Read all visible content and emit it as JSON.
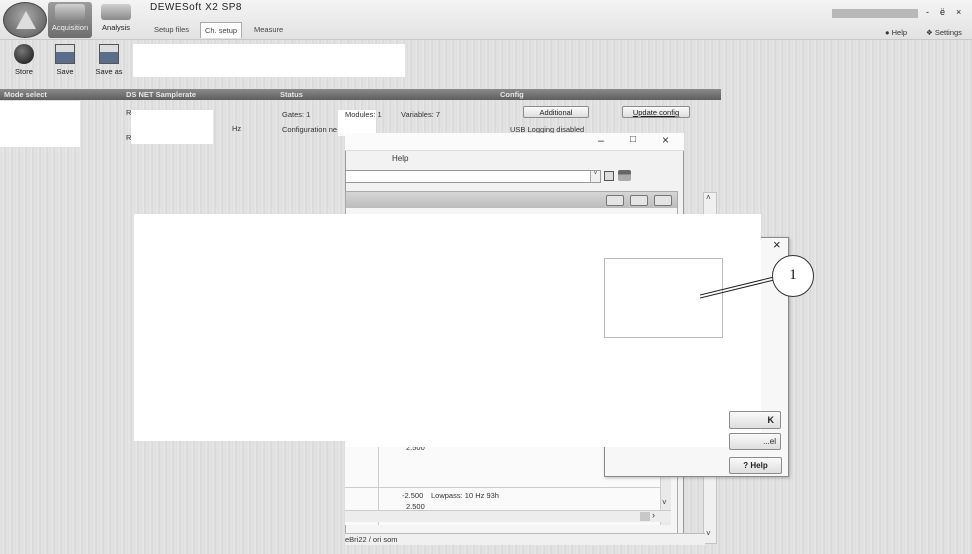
{
  "app": {
    "title": "DEWESoft X2 SP8"
  },
  "modes": [
    {
      "label": "Acquisition"
    },
    {
      "label": "Analysis"
    }
  ],
  "tabs": [
    {
      "label": "Setup files"
    },
    {
      "label": "Ch. setup"
    },
    {
      "label": "Measure"
    }
  ],
  "window_controls": {
    "minimize": "-",
    "restore": "ё",
    "close": "×"
  },
  "top_links": {
    "help": "Help",
    "settings": "Settings"
  },
  "toolbar": {
    "store": "Store",
    "save": "Save",
    "save_as": "Save as"
  },
  "header": {
    "mode_select": "Mode select",
    "ds_net": "DS NET Samplerate",
    "status": "Status",
    "config": "Config"
  },
  "content": {
    "gates": "Gates: 1",
    "modules": "Modules: 1",
    "variables": "Variables: 7",
    "configuration": "Configuration ne",
    "hz": "Hz",
    "usb_logging": "USB Logging disabled",
    "additional": "Additional",
    "update_config": "Update config",
    "r_label": "R",
    "r_label2": "R"
  },
  "dialog_back": {
    "menu_help": "Help",
    "combo_arrow": "˅"
  },
  "grid": {
    "row1_value": "2.500",
    "row2_value": "-2.500",
    "row2_text": "Lowpass: 10 Hz 93h",
    "row3_value": "2.500",
    "status": "eBri22 / ori som"
  },
  "front_dialog": {
    "close": "×",
    "ok": "K",
    "cancel": "...el",
    "help": "Help",
    "help_icon": "?"
  },
  "callout": {
    "label": "1"
  },
  "colors": {
    "header_bar": "#6e6e6e",
    "acquisition_active": "#7e7e7e",
    "background": "#e2e2e2"
  },
  "icons": [
    "dewesoft-logo-icon",
    "acquisition-icon",
    "analysis-icon",
    "store-icon",
    "save-icon",
    "save-as-icon",
    "print-icon",
    "help-icon",
    "settings-icon"
  ]
}
